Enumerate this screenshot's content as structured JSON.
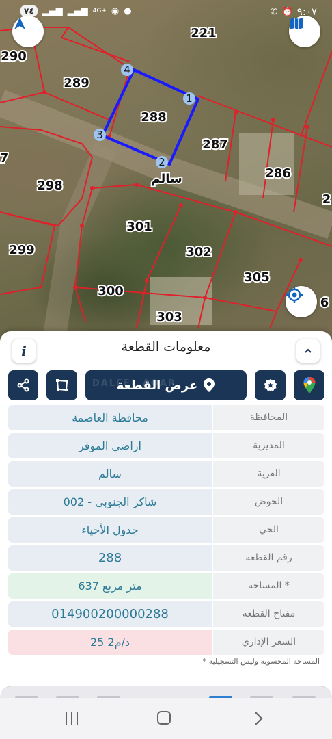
{
  "status_bar": {
    "battery": "٧٤",
    "network": "4G+",
    "time": "٩:٠٧"
  },
  "map": {
    "road_label": "سالم",
    "parcel_labels": [
      "221",
      "290",
      "289",
      "288",
      "287",
      "286",
      "7",
      "298",
      "2",
      "299",
      "301",
      "302",
      "305",
      "300",
      "303",
      "6"
    ],
    "vertex_labels": [
      "1",
      "2",
      "3",
      "4"
    ],
    "buttons": {
      "north": "north-arrow-icon",
      "layers": "map-layers-icon",
      "locate": "gps-target-icon"
    }
  },
  "panel": {
    "title": "معلومات القطعة",
    "info_button": "i",
    "actions": {
      "view_parcel": "عرض القطعة",
      "watermark": "DALEEL AQAR"
    },
    "rows": [
      {
        "label": "المحافظة",
        "value": "محافظة العاصمة"
      },
      {
        "label": "المديرية",
        "value": "اراضي الموقر"
      },
      {
        "label": "القرية",
        "value": "سالم"
      },
      {
        "label": "الحوض",
        "value": "شاكر الجنوبي - 002"
      },
      {
        "label": "الحي",
        "value": "جدول الأحياء"
      },
      {
        "label": "رقم القطعة",
        "value": "288"
      },
      {
        "label": "المساحة *",
        "value": "637 متر مربع"
      },
      {
        "label": "مفتاح القطعة",
        "value": "014900200000288"
      },
      {
        "label": "السعر الإداري",
        "value": "25 د/م2"
      }
    ],
    "footnote": "* المساحة المحسوبة وليس التسجيلية"
  },
  "colors": {
    "primary": "#1b3556",
    "value_text": "#2b7a96",
    "parcel_line": "#e0202a",
    "selected_parcel": "#1a1aff",
    "area_bg": "#e3f3e8",
    "price_bg": "#fbe0e3"
  }
}
